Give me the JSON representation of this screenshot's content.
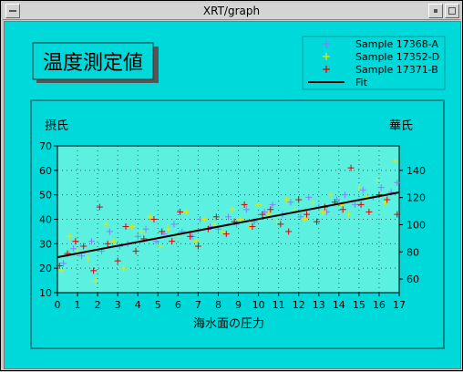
{
  "window": {
    "title": "XRT/graph"
  },
  "header": {
    "title": "温度測定値"
  },
  "legend": [
    {
      "label": "Sample 17368-A",
      "color": "#8080ff"
    },
    {
      "label": "Sample 17352-D",
      "color": "#e6e600"
    },
    {
      "label": "Sample 17371-B",
      "color": "#e00000"
    },
    {
      "label": "Fit",
      "color": "#000000"
    }
  ],
  "chart_data": {
    "type": "scatter",
    "title": "温度測定値",
    "xlabel": "海水面の圧力",
    "ylabel": "摂氏",
    "y2label": "華氏",
    "xlim": [
      0,
      17
    ],
    "ylim": [
      10,
      70
    ],
    "y2lim": [
      50,
      158
    ],
    "xticks": [
      0,
      1,
      2,
      3,
      4,
      5,
      6,
      7,
      8,
      9,
      10,
      11,
      12,
      13,
      14,
      15,
      16,
      17
    ],
    "yticks": [
      10,
      20,
      30,
      40,
      50,
      60,
      70
    ],
    "y2ticks": [
      60,
      80,
      100,
      120,
      140
    ],
    "grid": "dotted",
    "legend_position": "top-right",
    "fit": {
      "name": "Fit",
      "x": [
        0,
        17
      ],
      "y": [
        24.5,
        51
      ]
    },
    "series": [
      {
        "name": "Sample 17368-A",
        "color": "#8080ff",
        "x": [
          0.3,
          0.8,
          1.2,
          1.7,
          2.2,
          2.6,
          3.1,
          3.5,
          4.0,
          4.4,
          4.9,
          5.3,
          5.8,
          6.2,
          6.7,
          7.1,
          7.6,
          8.0,
          8.5,
          8.9,
          9.4,
          9.8,
          10.3,
          10.7,
          11.2,
          11.6,
          12.1,
          12.5,
          13.0,
          13.4,
          13.9,
          14.3,
          14.8,
          15.2,
          15.7,
          16.1,
          16.6,
          16.9
        ],
        "y": [
          22,
          28,
          25,
          31,
          27,
          35,
          29,
          30,
          33,
          36,
          31,
          34,
          38,
          35,
          33,
          40,
          37,
          36,
          41,
          38,
          44,
          39,
          43,
          46,
          42,
          47,
          41,
          49,
          45,
          43,
          48,
          50,
          46,
          52,
          49,
          53,
          51,
          55
        ]
      },
      {
        "name": "Sample 17352-D",
        "color": "#e6e600",
        "x": [
          0.2,
          0.6,
          1.0,
          1.5,
          1.9,
          2.4,
          2.8,
          3.3,
          3.7,
          4.2,
          4.6,
          5.1,
          5.5,
          6.0,
          6.4,
          6.9,
          7.3,
          7.8,
          8.2,
          8.7,
          9.1,
          9.6,
          10.0,
          10.5,
          10.9,
          11.4,
          11.8,
          12.3,
          12.7,
          13.2,
          13.6,
          14.1,
          14.5,
          15.0,
          15.4,
          15.9,
          16.3,
          16.8
        ],
        "y": [
          19,
          33,
          27,
          24,
          15,
          38,
          31,
          20,
          37,
          35,
          41,
          29,
          36,
          33,
          43,
          31,
          40,
          38,
          35,
          44,
          40,
          37,
          46,
          42,
          39,
          48,
          44,
          40,
          47,
          43,
          50,
          46,
          42,
          53,
          49,
          56,
          47,
          64
        ]
      },
      {
        "name": "Sample 17371-B",
        "color": "#e00000",
        "x": [
          0.1,
          0.5,
          0.9,
          1.3,
          1.8,
          2.1,
          2.5,
          3.0,
          3.4,
          3.9,
          4.3,
          4.8,
          5.2,
          5.7,
          6.1,
          6.6,
          7.0,
          7.5,
          7.9,
          8.4,
          8.8,
          9.3,
          9.7,
          10.2,
          10.6,
          11.1,
          11.5,
          12.0,
          12.4,
          12.9,
          13.3,
          13.8,
          14.2,
          14.6,
          15.1,
          15.5,
          16.0,
          16.4,
          16.9
        ],
        "y": [
          21,
          26,
          31,
          29,
          19,
          45,
          30,
          23,
          37,
          27,
          32,
          40,
          35,
          31,
          43,
          33,
          29,
          36,
          41,
          34,
          39,
          46,
          37,
          42,
          44,
          38,
          35,
          48,
          42,
          39,
          45,
          47,
          44,
          61,
          46,
          43,
          50,
          48,
          42
        ]
      }
    ]
  }
}
